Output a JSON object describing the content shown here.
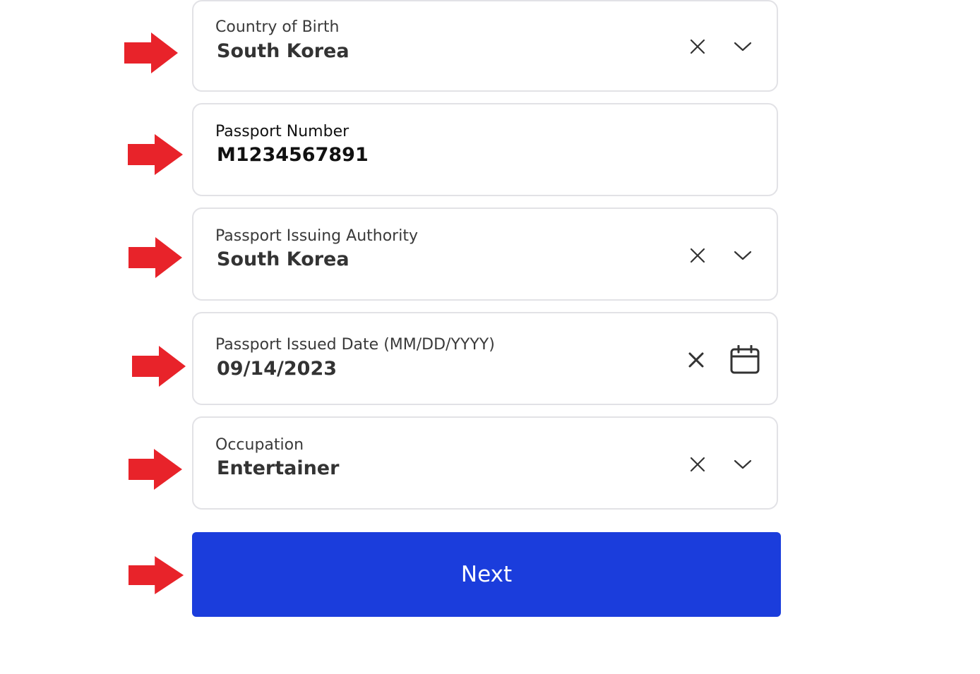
{
  "colors": {
    "field_border": "#e2e2e6",
    "primary_button": "#1b3ddc",
    "annotation_arrow": "#e8232a",
    "text": "#333333"
  },
  "fields": {
    "country_of_birth": {
      "label": "Country of Birth",
      "value": "South Korea",
      "icons": [
        "close-icon",
        "chevron-down-icon"
      ]
    },
    "passport_number": {
      "label": "Passport Number",
      "value": "M1234567891"
    },
    "passport_issuing_authority": {
      "label": "Passport Issuing Authority",
      "value": "South Korea",
      "icons": [
        "close-icon",
        "chevron-down-icon"
      ]
    },
    "passport_issued_date": {
      "label": "Passport Issued Date (MM/DD/YYYY)",
      "value": "09/14/2023",
      "icons": [
        "close-icon",
        "calendar-icon"
      ]
    },
    "occupation": {
      "label": "Occupation",
      "value": "Entertainer",
      "icons": [
        "close-icon",
        "chevron-down-icon"
      ]
    }
  },
  "actions": {
    "next_label": "Next"
  }
}
